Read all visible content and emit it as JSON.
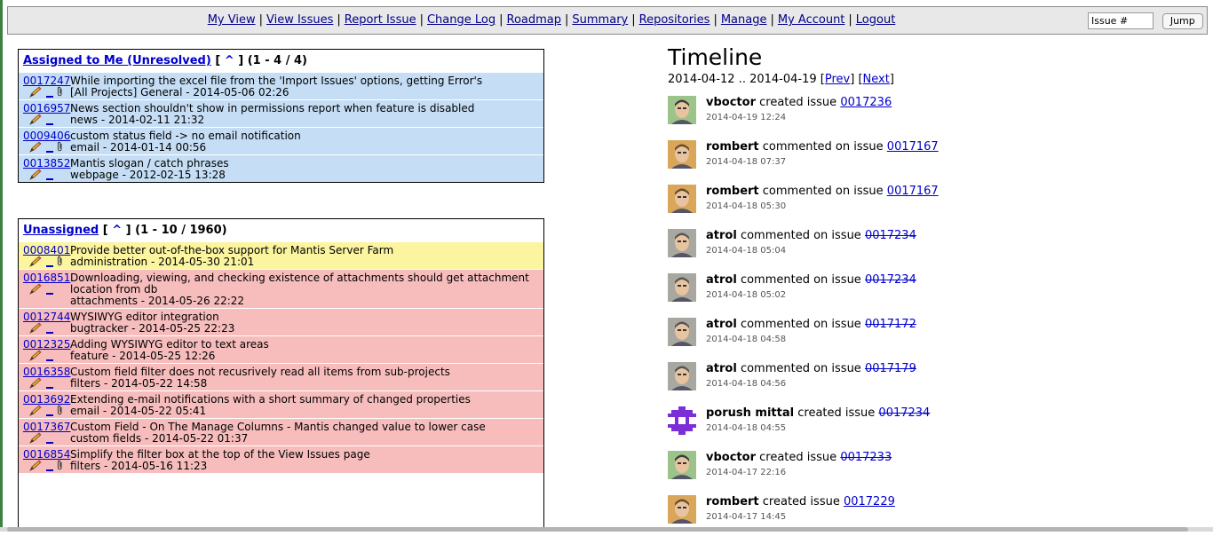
{
  "menu": {
    "items": [
      {
        "label": "My View"
      },
      {
        "label": "View Issues"
      },
      {
        "label": "Report Issue"
      },
      {
        "label": "Change Log"
      },
      {
        "label": "Roadmap"
      },
      {
        "label": "Summary"
      },
      {
        "label": "Repositories"
      },
      {
        "label": "Manage"
      },
      {
        "label": "My Account"
      },
      {
        "label": "Logout"
      }
    ],
    "separator": "|",
    "issue_input_value": "Issue #",
    "jump_label": "Jump"
  },
  "assigned": {
    "title": "Assigned to Me (Unresolved)",
    "caret_open": "[",
    "caret": "^",
    "caret_close": "]",
    "range": "(1 - 4 / 4)",
    "rows": [
      {
        "id": "0017247",
        "line1": "While importing the excel file from the 'Import Issues' options, getting Error's",
        "line2": "[All Projects] General - 2014-05-06 02:26",
        "color": "blue",
        "clip": true
      },
      {
        "id": "0016957",
        "line1": "News section shouldn't show in permissions report when feature is disabled",
        "line2": "news - 2014-02-11 21:32",
        "color": "blue",
        "clip": false
      },
      {
        "id": "0009406",
        "line1": "custom status field -> no email notification",
        "line2": "email - 2014-01-14 00:56",
        "color": "blue",
        "clip": true
      },
      {
        "id": "0013852",
        "line1": "Mantis slogan / catch phrases",
        "line2": "webpage - 2012-02-15 13:28",
        "color": "blue",
        "clip": false
      }
    ]
  },
  "unassigned": {
    "title": "Unassigned",
    "caret_open": "[",
    "caret": "^",
    "caret_close": "]",
    "range": "(1 - 10 / 1960)",
    "rows": [
      {
        "id": "0008401",
        "line1": "Provide better out-of-the-box support for Mantis Server Farm",
        "line2": "administration - 2014-05-30 21:01",
        "color": "yellow",
        "clip": true
      },
      {
        "id": "0016851",
        "line1": "Downloading, viewing, and checking existence of attachments should get attachment",
        "line1b": "location from db",
        "line2": "attachments - 2014-05-26 22:22",
        "color": "red",
        "clip": false
      },
      {
        "id": "0012744",
        "line1": "WYSIWYG editor integration",
        "line2": "bugtracker - 2014-05-25 22:23",
        "color": "red",
        "clip": false
      },
      {
        "id": "0012325",
        "line1": "Adding WYSIWYG editor to text areas",
        "line2": "feature - 2014-05-25 12:26",
        "color": "red",
        "clip": false
      },
      {
        "id": "0016358",
        "line1": "Custom field filter does not recusrively read all items from sub-projects",
        "line2": "filters - 2014-05-22 14:58",
        "color": "red",
        "clip": false
      },
      {
        "id": "0013692",
        "line1": "Extending e-mail notifications with a short summary of changed properties",
        "line2": "email - 2014-05-22 05:41",
        "color": "red",
        "clip": true
      },
      {
        "id": "0017367",
        "line1": "Custom Field - On The Manage Columns - Mantis changed value to lower case",
        "line2": "custom fields - 2014-05-22 01:37",
        "color": "red",
        "clip": false
      },
      {
        "id": "0016854",
        "line1": "Simplify the filter box at the top of the View Issues page",
        "line2": "filters - 2014-05-16 11:23",
        "color": "red",
        "clip": true
      }
    ]
  },
  "timeline": {
    "title": "Timeline",
    "range_text": "2014-04-12 .. 2014-04-19",
    "prev_label": "Prev",
    "next_label": "Next",
    "entries": [
      {
        "user": "vboctor",
        "action": "created issue",
        "issue": "0017236",
        "date": "2014-04-19 12:24",
        "avatar": "photo-green",
        "resolved": false
      },
      {
        "user": "rombert",
        "action": "commented on issue",
        "issue": "0017167",
        "date": "2014-04-18 07:37",
        "avatar": "photo-tan",
        "resolved": false
      },
      {
        "user": "rombert",
        "action": "commented on issue",
        "issue": "0017167",
        "date": "2014-04-18 05:30",
        "avatar": "photo-tan",
        "resolved": false
      },
      {
        "user": "atrol",
        "action": "commented on issue",
        "issue": "0017234",
        "date": "2014-04-18 05:04",
        "avatar": "photo-grey",
        "resolved": true
      },
      {
        "user": "atrol",
        "action": "commented on issue",
        "issue": "0017234",
        "date": "2014-04-18 05:02",
        "avatar": "photo-grey",
        "resolved": true
      },
      {
        "user": "atrol",
        "action": "commented on issue",
        "issue": "0017172",
        "date": "2014-04-18 04:58",
        "avatar": "photo-grey",
        "resolved": true
      },
      {
        "user": "atrol",
        "action": "commented on issue",
        "issue": "0017179",
        "date": "2014-04-18 04:56",
        "avatar": "photo-grey",
        "resolved": true
      },
      {
        "user": "porush mittal",
        "action": "created issue",
        "issue": "0017234",
        "date": "2014-04-18 04:55",
        "avatar": "identicon-purple",
        "resolved": true
      },
      {
        "user": "vboctor",
        "action": "created issue",
        "issue": "0017233",
        "date": "2014-04-17 22:16",
        "avatar": "photo-green",
        "resolved": true
      },
      {
        "user": "rombert",
        "action": "created issue",
        "issue": "0017229",
        "date": "2014-04-17 14:45",
        "avatar": "photo-tan",
        "resolved": false
      }
    ]
  },
  "colors": {
    "row_blue": "#c5def5",
    "row_yellow": "#fcf5a0",
    "row_red": "#f7bdbd",
    "link": "#0000cc"
  }
}
